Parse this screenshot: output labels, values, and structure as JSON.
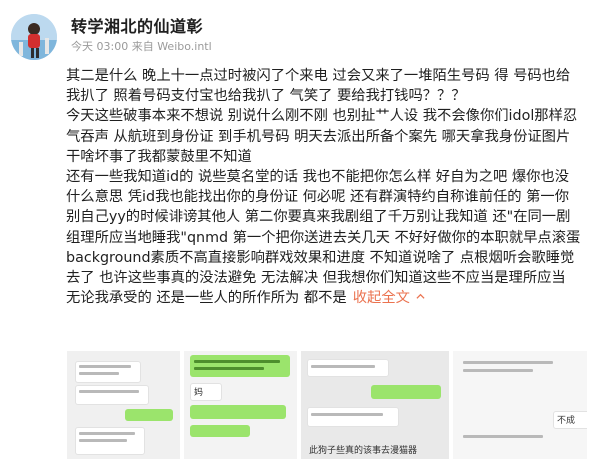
{
  "post": {
    "username": "转学湘北的仙道彰",
    "time": "今天 03:00",
    "source": "来自 Weibo.intl",
    "lines": [
      "其二是什么 晚上十一点过时被闪了个来电 过会又来了一堆陌生号码 得 号码也给",
      "我扒了 照着号码支付宝也给我扒了 气笑了 要给我打钱吗？？？",
      "今天这些破事本来不想说 别说什么刚不刚 也别扯艹人设 我不会像你们idol那样忍",
      "气吞声 从航班到身份证 到手机号码 明天去派出所备个案先 哪天拿我身份证图片",
      "干啥坏事了我都蒙鼓里不知道",
      "还有一些我知道id的 说些莫名堂的话 我也不能把你怎么样 好自为之吧 爆你也没",
      "什么意思 凭id我也能找出你的身份证 何必呢 还有群演特约自称谁前任的 第一你",
      "别自己yy的时候诽谤其他人 第二你要真来我剧组了千万别让我知道 还\"在同一剧",
      "组理所应当地睡我\"qnmd 第一个把你送进去关几天 不好好做你的本职就早点滚蛋",
      "background素质不高直接影响群戏效果和进度 不知道说啥了 点根烟听会歌睡觉",
      "去了 也许这些事真的没法避免 无法解决 但我想你们知道这些不应当是理所应当",
      "无论我承受的 还是一些人的所作所为 都不是"
    ],
    "expand_label": "收起全文"
  },
  "thumbs": {
    "t2_text": [
      "妈",
      "不成"
    ],
    "t3_text": "此狗子些真的该事去漫猫器"
  },
  "colors": {
    "link": "#eb7350",
    "meta": "#9a9a9a",
    "chat_green": "#9be46c"
  }
}
